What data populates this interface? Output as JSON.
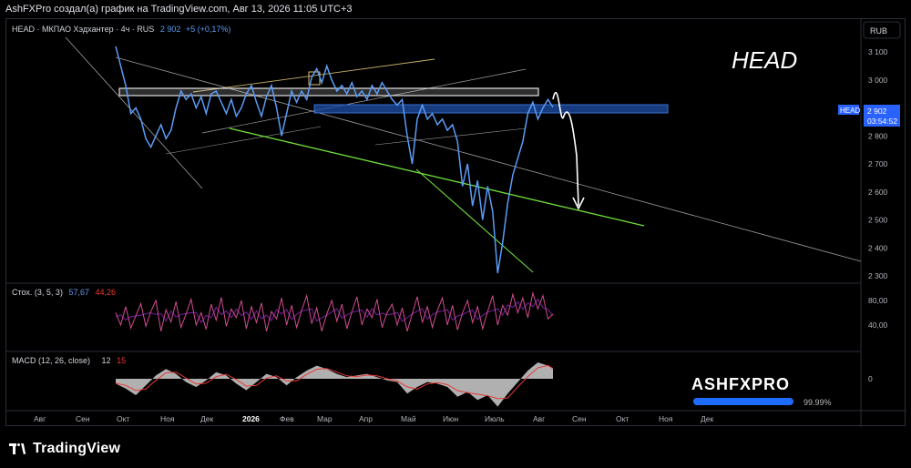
{
  "header": {
    "attribution": "AshFXPro создал(а) график на TradingView.com, Авг 13, 2026 11:05 UTC+3"
  },
  "chart_title": {
    "symbol": "HEAD",
    "name": "МКПАО Хэдхантер",
    "interval": "4ч",
    "exchange": "RUS",
    "last": "2 902",
    "change": "+5 (+0,17%)"
  },
  "currency_badge": "RUB",
  "overlay_title": "HEAD",
  "price_tag": {
    "symbol": "HEAD",
    "price": "2 902",
    "countdown": "03:54:52"
  },
  "price_axis": [
    "3 100",
    "3 000",
    "2 900",
    "2 800",
    "2 700",
    "2 600",
    "2 500",
    "2 400",
    "2 300"
  ],
  "stoch": {
    "label": "Стох. (3, 5, 3)",
    "k": "57,67",
    "d": "44,26",
    "axis": [
      "80,00",
      "40,00"
    ]
  },
  "macd": {
    "label": "MACD (12, 26, close)",
    "macd": "12",
    "signal": "15",
    "axis": [
      "0"
    ]
  },
  "watermark": {
    "brand": "ASHFXPRO",
    "progress_label": "99.99%",
    "progress": 0.9999
  },
  "time_axis": [
    "Авг",
    "Сен",
    "Окт",
    "Ноя",
    "Дек",
    "2026",
    "Фев",
    "Мар",
    "Апр",
    "Май",
    "Июн",
    "Июль",
    "Авг",
    "Сен",
    "Окт",
    "Ноя",
    "Дек"
  ],
  "footer": {
    "logo_text": "TradingView"
  },
  "colors": {
    "price_line": "#5b9cf6",
    "support_line": "#4caf50",
    "zone_blue": "#1e4fa8",
    "stoch_k": "#c2185b",
    "stoch_d": "#7b1fa2",
    "macd_area": "#d8d8d8",
    "macd_signal": "#e53935"
  },
  "chart_data": {
    "type": "line",
    "ylim": [
      2280,
      3150
    ],
    "price": [
      [
        0,
        3120
      ],
      [
        2,
        3050
      ],
      [
        4,
        2980
      ],
      [
        6,
        2880
      ],
      [
        8,
        2900
      ],
      [
        10,
        2860
      ],
      [
        12,
        2790
      ],
      [
        14,
        2760
      ],
      [
        16,
        2800
      ],
      [
        18,
        2840
      ],
      [
        20,
        2790
      ],
      [
        22,
        2820
      ],
      [
        24,
        2900
      ],
      [
        26,
        2960
      ],
      [
        28,
        2930
      ],
      [
        30,
        2950
      ],
      [
        32,
        2900
      ],
      [
        34,
        2940
      ],
      [
        36,
        2880
      ],
      [
        38,
        2950
      ],
      [
        40,
        2960
      ],
      [
        42,
        2920
      ],
      [
        44,
        2880
      ],
      [
        46,
        2930
      ],
      [
        48,
        2870
      ],
      [
        50,
        2900
      ],
      [
        52,
        2950
      ],
      [
        54,
        2980
      ],
      [
        56,
        2920
      ],
      [
        58,
        2870
      ],
      [
        60,
        2940
      ],
      [
        62,
        2980
      ],
      [
        64,
        2900
      ],
      [
        66,
        2800
      ],
      [
        68,
        2880
      ],
      [
        70,
        2960
      ],
      [
        72,
        2920
      ],
      [
        74,
        2960
      ],
      [
        76,
        2930
      ],
      [
        78,
        3010
      ],
      [
        80,
        3040
      ],
      [
        82,
        2990
      ],
      [
        84,
        3050
      ],
      [
        86,
        3000
      ],
      [
        88,
        2960
      ],
      [
        90,
        2980
      ],
      [
        92,
        2950
      ],
      [
        94,
        2990
      ],
      [
        96,
        2940
      ],
      [
        98,
        2960
      ],
      [
        100,
        2930
      ],
      [
        102,
        2980
      ],
      [
        104,
        2950
      ],
      [
        106,
        2990
      ],
      [
        108,
        2960
      ],
      [
        110,
        2930
      ],
      [
        112,
        2910
      ],
      [
        114,
        2930
      ],
      [
        116,
        2800
      ],
      [
        118,
        2700
      ],
      [
        120,
        2860
      ],
      [
        122,
        2910
      ],
      [
        124,
        2860
      ],
      [
        126,
        2880
      ],
      [
        128,
        2840
      ],
      [
        130,
        2860
      ],
      [
        132,
        2820
      ],
      [
        134,
        2840
      ],
      [
        136,
        2780
      ],
      [
        138,
        2620
      ],
      [
        140,
        2700
      ],
      [
        142,
        2550
      ],
      [
        144,
        2640
      ],
      [
        146,
        2500
      ],
      [
        148,
        2620
      ],
      [
        150,
        2530
      ],
      [
        152,
        2310
      ],
      [
        154,
        2420
      ],
      [
        156,
        2560
      ],
      [
        158,
        2660
      ],
      [
        160,
        2720
      ],
      [
        162,
        2780
      ],
      [
        164,
        2880
      ],
      [
        166,
        2920
      ],
      [
        168,
        2860
      ],
      [
        170,
        2900
      ],
      [
        172,
        2930
      ],
      [
        174,
        2902
      ]
    ],
    "stoch": [
      [
        0,
        60
      ],
      [
        2,
        40
      ],
      [
        4,
        70
      ],
      [
        6,
        35
      ],
      [
        8,
        55
      ],
      [
        10,
        75
      ],
      [
        12,
        38
      ],
      [
        14,
        62
      ],
      [
        16,
        80
      ],
      [
        18,
        30
      ],
      [
        20,
        65
      ],
      [
        22,
        45
      ],
      [
        24,
        78
      ],
      [
        26,
        36
      ],
      [
        28,
        58
      ],
      [
        30,
        82
      ],
      [
        32,
        40
      ],
      [
        34,
        60
      ],
      [
        36,
        33
      ],
      [
        38,
        74
      ],
      [
        40,
        48
      ],
      [
        42,
        85
      ],
      [
        44,
        38
      ],
      [
        46,
        66
      ],
      [
        48,
        52
      ],
      [
        50,
        80
      ],
      [
        52,
        34
      ],
      [
        54,
        70
      ],
      [
        56,
        44
      ],
      [
        58,
        76
      ],
      [
        60,
        30
      ],
      [
        62,
        62
      ],
      [
        64,
        50
      ],
      [
        66,
        84
      ],
      [
        68,
        40
      ],
      [
        70,
        72
      ],
      [
        72,
        36
      ],
      [
        74,
        64
      ],
      [
        76,
        88
      ],
      [
        78,
        42
      ],
      [
        80,
        68
      ],
      [
        82,
        30
      ],
      [
        84,
        58
      ],
      [
        86,
        80
      ],
      [
        88,
        46
      ],
      [
        90,
        74
      ],
      [
        92,
        34
      ],
      [
        94,
        62
      ],
      [
        96,
        86
      ],
      [
        98,
        40
      ],
      [
        100,
        66
      ],
      [
        102,
        52
      ],
      [
        104,
        82
      ],
      [
        106,
        36
      ],
      [
        108,
        60
      ],
      [
        110,
        74
      ],
      [
        112,
        40
      ],
      [
        114,
        68
      ],
      [
        116,
        30
      ],
      [
        118,
        58
      ],
      [
        120,
        86
      ],
      [
        122,
        44
      ],
      [
        124,
        70
      ],
      [
        126,
        36
      ],
      [
        128,
        64
      ],
      [
        130,
        84
      ],
      [
        132,
        40
      ],
      [
        134,
        72
      ],
      [
        136,
        32
      ],
      [
        138,
        60
      ],
      [
        140,
        80
      ],
      [
        142,
        44
      ],
      [
        144,
        70
      ],
      [
        146,
        34
      ],
      [
        148,
        62
      ],
      [
        150,
        88
      ],
      [
        152,
        40
      ],
      [
        154,
        72
      ],
      [
        156,
        56
      ],
      [
        158,
        90
      ],
      [
        160,
        60
      ],
      [
        162,
        84
      ],
      [
        164,
        52
      ],
      [
        166,
        92
      ],
      [
        168,
        66
      ],
      [
        170,
        88
      ],
      [
        172,
        50
      ],
      [
        174,
        58
      ]
    ],
    "macd": [
      [
        0,
        -6
      ],
      [
        4,
        -12
      ],
      [
        8,
        -20
      ],
      [
        12,
        -8
      ],
      [
        16,
        4
      ],
      [
        20,
        12
      ],
      [
        24,
        6
      ],
      [
        28,
        -4
      ],
      [
        32,
        -10
      ],
      [
        36,
        -2
      ],
      [
        40,
        8
      ],
      [
        44,
        4
      ],
      [
        48,
        -6
      ],
      [
        52,
        -14
      ],
      [
        56,
        -4
      ],
      [
        60,
        6
      ],
      [
        64,
        2
      ],
      [
        68,
        -8
      ],
      [
        72,
        2
      ],
      [
        76,
        10
      ],
      [
        80,
        16
      ],
      [
        84,
        12
      ],
      [
        88,
        6
      ],
      [
        92,
        2
      ],
      [
        96,
        4
      ],
      [
        100,
        6
      ],
      [
        104,
        2
      ],
      [
        108,
        -2
      ],
      [
        112,
        -4
      ],
      [
        116,
        -18
      ],
      [
        120,
        -10
      ],
      [
        124,
        -4
      ],
      [
        128,
        -6
      ],
      [
        132,
        -10
      ],
      [
        136,
        -22
      ],
      [
        140,
        -16
      ],
      [
        144,
        -26
      ],
      [
        148,
        -20
      ],
      [
        152,
        -34
      ],
      [
        156,
        -18
      ],
      [
        160,
        -4
      ],
      [
        164,
        10
      ],
      [
        168,
        20
      ],
      [
        172,
        16
      ],
      [
        174,
        12
      ]
    ]
  }
}
